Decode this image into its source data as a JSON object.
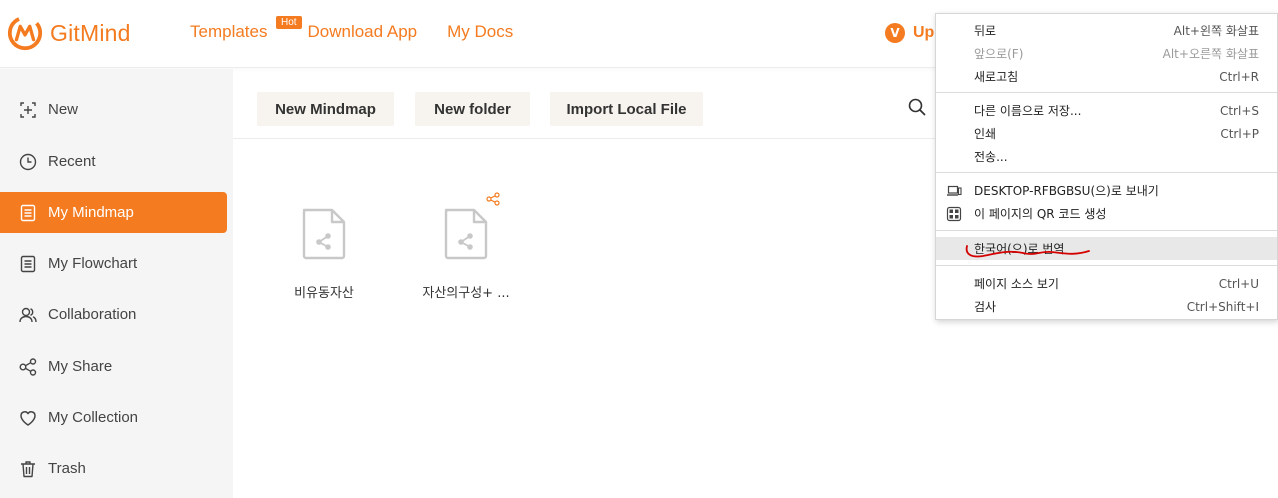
{
  "header": {
    "logo_text": "GitMind",
    "nav": [
      {
        "label": "Templates",
        "badge": "Hot"
      },
      {
        "label": "Download App"
      },
      {
        "label": "My Docs"
      }
    ],
    "upgrade_label": "Up",
    "upgrade_icon": "V"
  },
  "sidebar": {
    "items": [
      {
        "label": "New",
        "icon": "plus-box-icon"
      },
      {
        "label": "Recent",
        "icon": "clock-icon"
      },
      {
        "label": "My Mindmap",
        "icon": "document-icon",
        "active": true
      },
      {
        "label": "My Flowchart",
        "icon": "document-icon"
      },
      {
        "label": "Collaboration",
        "icon": "users-icon"
      },
      {
        "label": "My Share",
        "icon": "share-icon"
      },
      {
        "label": "My Collection",
        "icon": "heart-icon"
      },
      {
        "label": "Trash",
        "icon": "trash-icon"
      }
    ]
  },
  "toolbar": {
    "new_mindmap": "New Mindmap",
    "new_folder": "New folder",
    "import_file": "Import Local File"
  },
  "files": [
    {
      "name": "비유동자산",
      "shared": false
    },
    {
      "name": "자산의구성+ ...",
      "shared": true
    }
  ],
  "context_menu": {
    "items": [
      {
        "label": "뒤로",
        "shortcut": "Alt+왼쪽 화살표"
      },
      {
        "label": "앞으로(F)",
        "shortcut": "Alt+오른쪽 화살표",
        "disabled": true
      },
      {
        "label": "새로고침",
        "shortcut": "Ctrl+R"
      },
      {
        "label": "다른 이름으로 저장...",
        "shortcut": "Ctrl+S"
      },
      {
        "label": "인쇄",
        "shortcut": "Ctrl+P"
      },
      {
        "label": "전송...",
        "shortcut": ""
      },
      {
        "label": "DESKTOP-RFBGBSU(으)로 보내기",
        "shortcut": "",
        "icon": "laptop-icon"
      },
      {
        "label": "이 페이지의 QR 코드 생성",
        "shortcut": "",
        "icon": "qr-code-icon"
      },
      {
        "label": "한국어(으)로 번역",
        "shortcut": "",
        "highlighted": true
      },
      {
        "label": "페이지 소스 보기",
        "shortcut": "Ctrl+U"
      },
      {
        "label": "검사",
        "shortcut": "Ctrl+Shift+I"
      }
    ]
  },
  "colors": {
    "accent": "#f47b20",
    "sidebar_bg": "#f5f5f5",
    "button_bg": "#f7f3ee",
    "annotation": "#d40000"
  }
}
